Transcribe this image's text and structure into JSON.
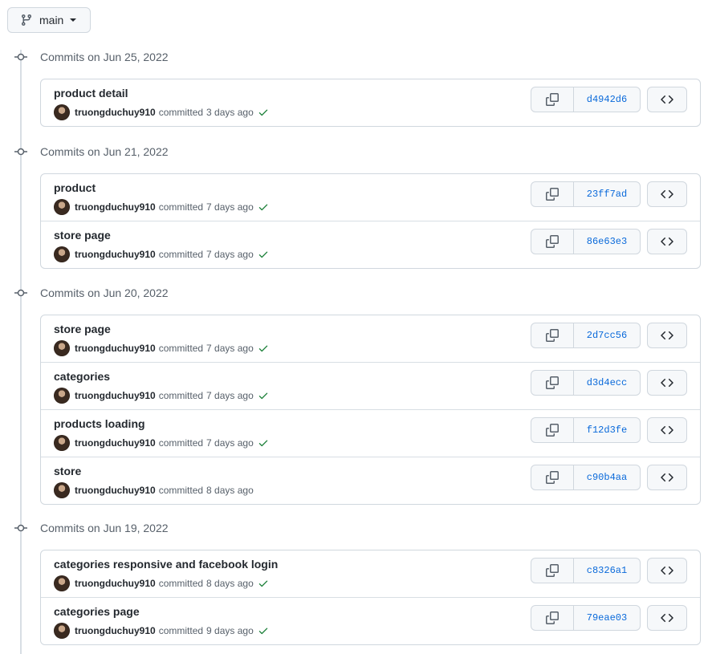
{
  "branch": {
    "name": "main",
    "icon": "git-branch-icon"
  },
  "colors": {
    "link": "#0969da",
    "success": "#1a7f37",
    "muted": "#57606a",
    "border": "#d0d7de"
  },
  "groups": [
    {
      "title": "Commits on Jun 25, 2022",
      "commits": [
        {
          "message": "product detail",
          "author": "truongduchuy910",
          "verb": "committed",
          "time": "3 days ago",
          "sha": "d4942d6",
          "verified": true
        }
      ]
    },
    {
      "title": "Commits on Jun 21, 2022",
      "commits": [
        {
          "message": "product",
          "author": "truongduchuy910",
          "verb": "committed",
          "time": "7 days ago",
          "sha": "23ff7ad",
          "verified": true
        },
        {
          "message": "store page",
          "author": "truongduchuy910",
          "verb": "committed",
          "time": "7 days ago",
          "sha": "86e63e3",
          "verified": true
        }
      ]
    },
    {
      "title": "Commits on Jun 20, 2022",
      "commits": [
        {
          "message": "store page",
          "author": "truongduchuy910",
          "verb": "committed",
          "time": "7 days ago",
          "sha": "2d7cc56",
          "verified": true
        },
        {
          "message": "categories",
          "author": "truongduchuy910",
          "verb": "committed",
          "time": "7 days ago",
          "sha": "d3d4ecc",
          "verified": true
        },
        {
          "message": "products loading",
          "author": "truongduchuy910",
          "verb": "committed",
          "time": "7 days ago",
          "sha": "f12d3fe",
          "verified": true
        },
        {
          "message": "store",
          "author": "truongduchuy910",
          "verb": "committed",
          "time": "8 days ago",
          "sha": "c90b4aa",
          "verified": false
        }
      ]
    },
    {
      "title": "Commits on Jun 19, 2022",
      "commits": [
        {
          "message": "categories responsive and facebook login",
          "author": "truongduchuy910",
          "verb": "committed",
          "time": "8 days ago",
          "sha": "c8326a1",
          "verified": true
        },
        {
          "message": "categories page",
          "author": "truongduchuy910",
          "verb": "committed",
          "time": "9 days ago",
          "sha": "79eae03",
          "verified": true
        }
      ]
    }
  ]
}
